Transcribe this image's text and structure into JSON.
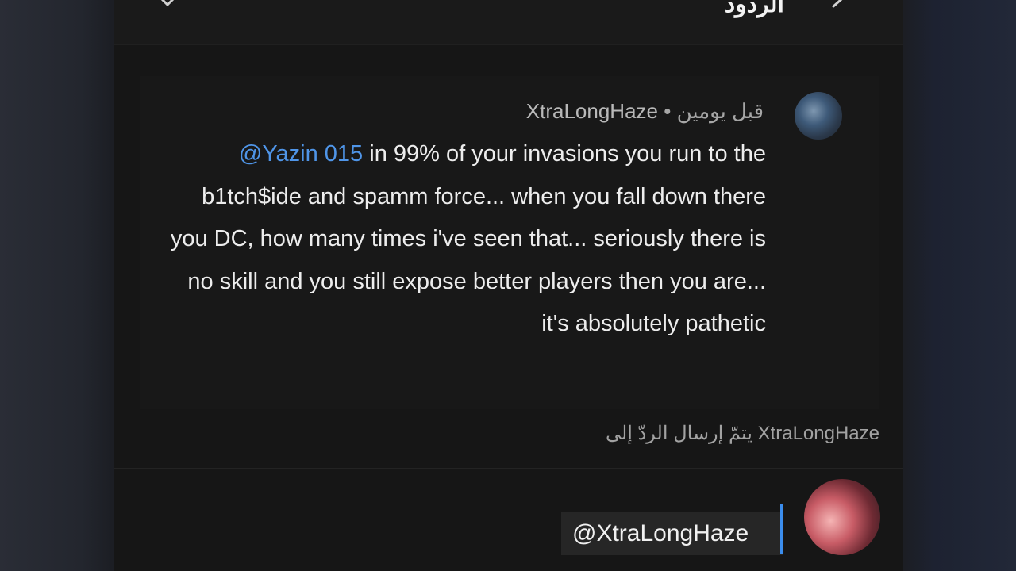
{
  "header": {
    "title": "الردود",
    "close_icon": "close-icon",
    "back_icon": "chevron-right-icon"
  },
  "comment": {
    "author": "XtraLongHaze",
    "separator": "•",
    "time": "قبل يومين",
    "mention": "@Yazin 015",
    "text": "in 99% of your invasions you run to the b1tch$ide and spamm force... when you fall down there you DC, how many times i've seen that... seriously there is no skill and you still expose better players then you are... it's absolutely pathetic"
  },
  "reply_notice": "يتمّ إرسال الردّ إلى XtraLongHaze",
  "reply_input": {
    "value": "@XtraLongHaze"
  },
  "colors": {
    "mention": "#4f95e8",
    "caret": "#3b8ded",
    "panel": "#161616"
  }
}
